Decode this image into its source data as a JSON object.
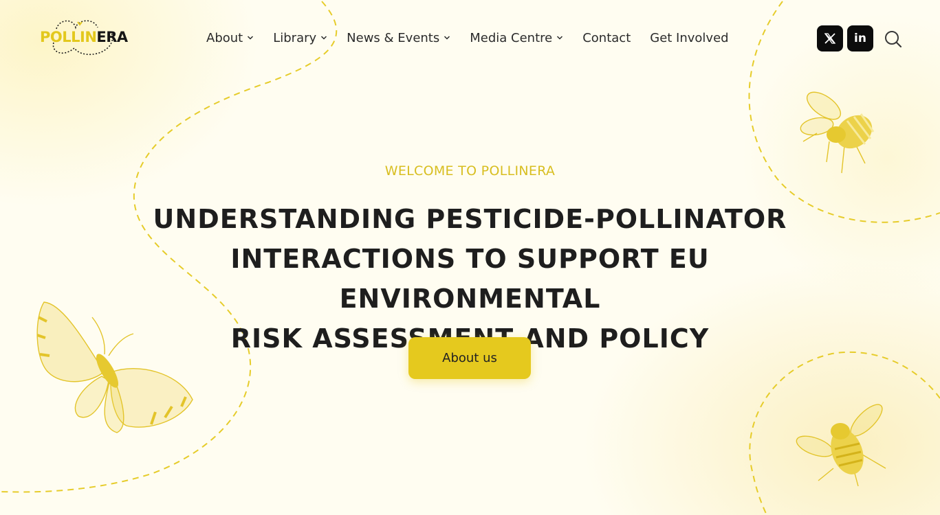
{
  "brand": {
    "logo_part1": "POLLIN",
    "logo_part2": "ERA",
    "accent_color": "#e5c91e",
    "text_color": "#1e1e1e"
  },
  "nav": {
    "items": [
      {
        "label": "About",
        "has_dropdown": true
      },
      {
        "label": "Library",
        "has_dropdown": true
      },
      {
        "label": "News & Events",
        "has_dropdown": true
      },
      {
        "label": "Media Centre",
        "has_dropdown": true
      },
      {
        "label": "Contact",
        "has_dropdown": false
      },
      {
        "label": "Get Involved",
        "has_dropdown": false
      }
    ]
  },
  "social": {
    "x_icon": "x-twitter-icon",
    "linkedin_label": "in",
    "search_icon": "search-icon"
  },
  "hero": {
    "eyebrow": "WELCOME TO POLLINERA",
    "headline_line1": "UNDERSTANDING PESTICIDE-POLLINATOR",
    "headline_line2": "INTERACTIONS TO SUPPORT EU ENVIRONMENTAL",
    "headline_line3": "RISK ASSESSMENT AND POLICY",
    "cta_label": "About us"
  }
}
